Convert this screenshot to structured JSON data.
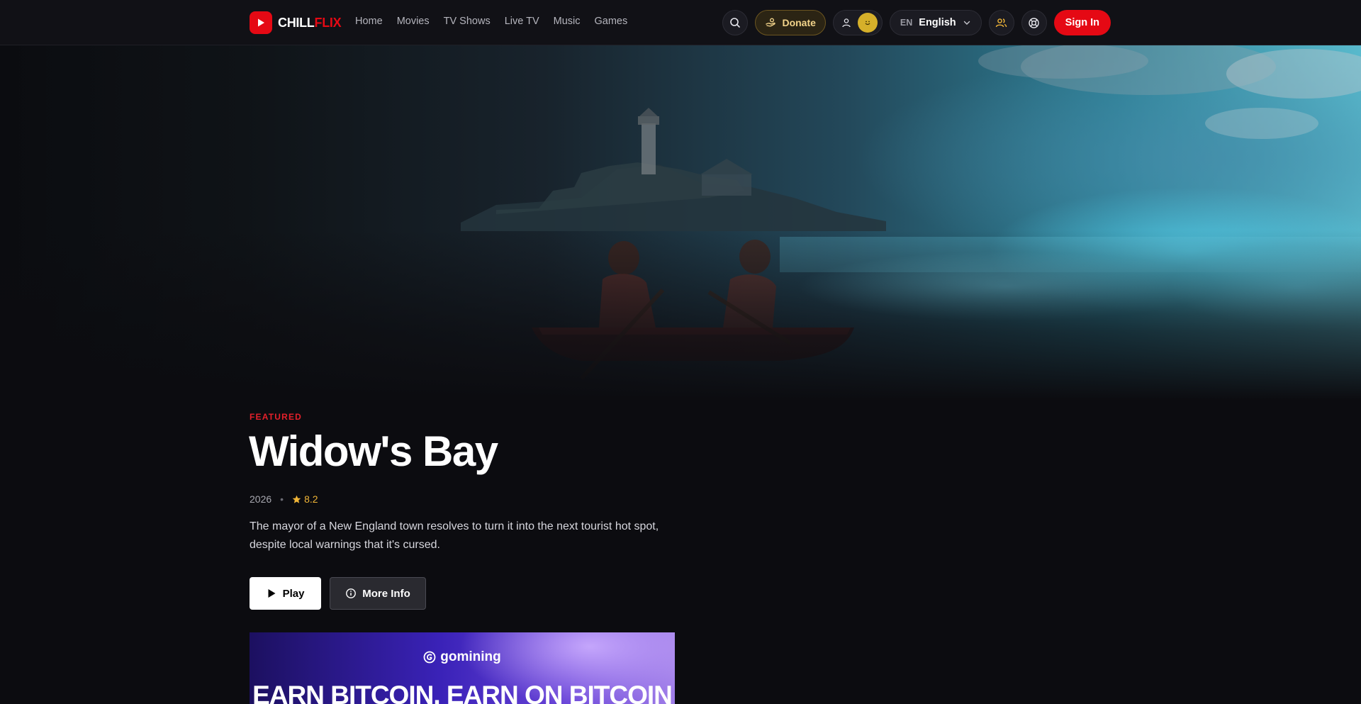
{
  "header": {
    "brand": {
      "part1": "CHILL",
      "part2": "FLIX"
    },
    "nav": [
      {
        "label": "Home"
      },
      {
        "label": "Movies"
      },
      {
        "label": "TV Shows"
      },
      {
        "label": "Live TV"
      },
      {
        "label": "Music"
      },
      {
        "label": "Games"
      }
    ],
    "donate_label": "Donate",
    "language": {
      "code": "EN",
      "name": "English"
    },
    "signin_label": "Sign In"
  },
  "featured": {
    "eyebrow": "FEATURED",
    "title": "Widow's Bay",
    "year": "2026",
    "separator": "•",
    "rating": "8.2",
    "description": "The mayor of a New England town resolves to turn it into the next tourist hot spot, despite local warnings that it's cursed.",
    "play_label": "Play",
    "info_label": "More Info"
  },
  "ad": {
    "brand": "gomining",
    "headline": "EARN BITCOIN. EARN ON BITCOIN"
  },
  "colors": {
    "accent": "#e50914",
    "rating": "#f0b537",
    "background": "#0c0c10"
  }
}
